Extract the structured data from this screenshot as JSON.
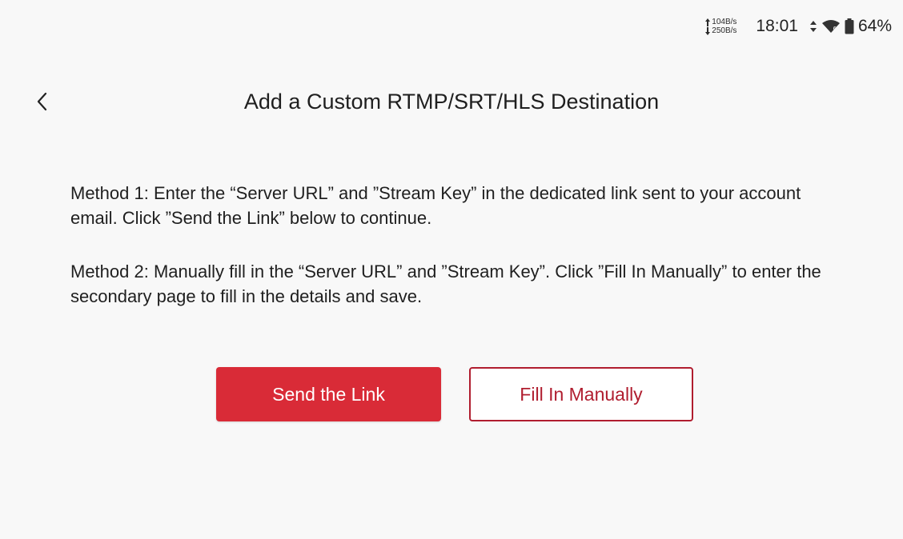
{
  "status_bar": {
    "upload_speed": "104B/s",
    "download_speed": "250B/s",
    "time": "18:01",
    "battery_percent": "64%",
    "icons": [
      "data-transfer-icon",
      "wifi-icon",
      "battery-icon"
    ]
  },
  "header": {
    "back_icon": "chevron-left-icon",
    "title": "Add a Custom RTMP/SRT/HLS Destination"
  },
  "content": {
    "method_1": "Method 1: Enter the “Server URL” and ”Stream Key” in the dedicated link sent to your account email. Click ”Send the Link” below to continue.",
    "method_2": "Method 2: Manually fill in the “Server URL” and ”Stream Key”. Click ”Fill In Manually” to enter the secondary page to fill in the details and save."
  },
  "buttons": {
    "send_link": "Send the Link",
    "fill_manually": "Fill In Manually"
  },
  "colors": {
    "primary_red": "#d92b37",
    "outline_red": "#b01d2f",
    "background": "#f8f8f8"
  }
}
